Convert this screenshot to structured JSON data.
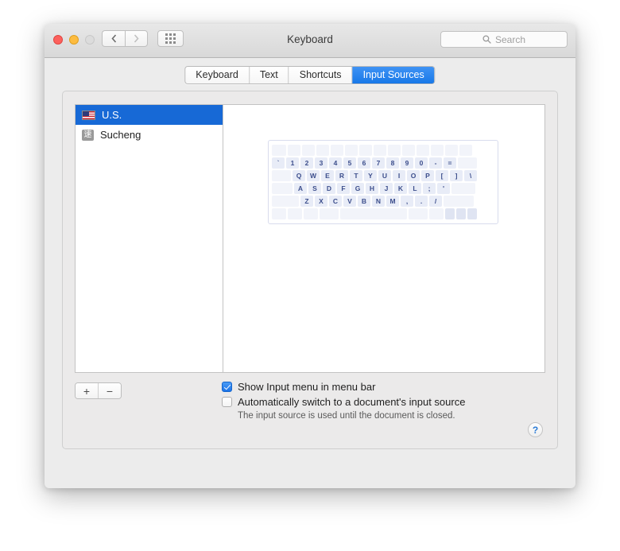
{
  "window": {
    "title": "Keyboard",
    "traffic_lights": {
      "close": "close-button",
      "minimize": "minimize-button",
      "zoom": "zoom-button"
    },
    "nav": {
      "back_icon": "chevron-left-icon",
      "forward_icon": "chevron-right-icon",
      "grid_icon": "show-all-grid-icon"
    }
  },
  "search": {
    "placeholder": "Search",
    "value": "",
    "icon": "search-icon"
  },
  "tabs": [
    {
      "label": "Keyboard",
      "active": false
    },
    {
      "label": "Text",
      "active": false
    },
    {
      "label": "Shortcuts",
      "active": false
    },
    {
      "label": "Input Sources",
      "active": true
    }
  ],
  "input_sources": [
    {
      "label": "U.S.",
      "icon": "us-flag-icon",
      "selected": true
    },
    {
      "label": "Sucheng",
      "icon": "sucheng-ime-icon",
      "icon_glyph": "速",
      "selected": false
    }
  ],
  "source_buttons": {
    "add_label": "+",
    "remove_label": "−"
  },
  "keyboard_preview": {
    "rows": [
      [
        {
          "label": "",
          "w": "w18",
          "blank": true
        },
        {
          "label": "",
          "w": "w16",
          "blank": true
        },
        {
          "label": "",
          "w": "w16",
          "blank": true
        },
        {
          "label": "",
          "w": "w16",
          "blank": true
        },
        {
          "label": "",
          "w": "w16",
          "blank": true
        },
        {
          "label": "",
          "w": "w16",
          "blank": true
        },
        {
          "label": "",
          "w": "w16",
          "blank": true
        },
        {
          "label": "",
          "w": "w16",
          "blank": true
        },
        {
          "label": "",
          "w": "w16",
          "blank": true
        },
        {
          "label": "",
          "w": "w16",
          "blank": true
        },
        {
          "label": "",
          "w": "w16",
          "blank": true
        },
        {
          "label": "",
          "w": "w16",
          "blank": true
        },
        {
          "label": "",
          "w": "w16",
          "blank": true
        },
        {
          "label": "",
          "w": "w16",
          "blank": true
        }
      ],
      [
        {
          "label": "`",
          "w": "w16"
        },
        {
          "label": "1",
          "w": "w16"
        },
        {
          "label": "2",
          "w": "w16"
        },
        {
          "label": "3",
          "w": "w16"
        },
        {
          "label": "4",
          "w": "w16"
        },
        {
          "label": "5",
          "w": "w16"
        },
        {
          "label": "6",
          "w": "w16"
        },
        {
          "label": "7",
          "w": "w16"
        },
        {
          "label": "8",
          "w": "w16"
        },
        {
          "label": "9",
          "w": "w16"
        },
        {
          "label": "0",
          "w": "w16"
        },
        {
          "label": "-",
          "w": "w16"
        },
        {
          "label": "=",
          "w": "w16"
        },
        {
          "label": "",
          "w": "w24",
          "blank": true
        }
      ],
      [
        {
          "label": "",
          "w": "w24",
          "blank": true
        },
        {
          "label": "Q",
          "w": "w16"
        },
        {
          "label": "W",
          "w": "w16"
        },
        {
          "label": "E",
          "w": "w16"
        },
        {
          "label": "R",
          "w": "w16"
        },
        {
          "label": "T",
          "w": "w16"
        },
        {
          "label": "Y",
          "w": "w16"
        },
        {
          "label": "U",
          "w": "w16"
        },
        {
          "label": "I",
          "w": "w16"
        },
        {
          "label": "O",
          "w": "w16"
        },
        {
          "label": "P",
          "w": "w16"
        },
        {
          "label": "[",
          "w": "w16"
        },
        {
          "label": "]",
          "w": "w16"
        },
        {
          "label": "\\",
          "w": "w16"
        }
      ],
      [
        {
          "label": "",
          "w": "w26",
          "blank": true
        },
        {
          "label": "A",
          "w": "w16"
        },
        {
          "label": "S",
          "w": "w16"
        },
        {
          "label": "D",
          "w": "w16"
        },
        {
          "label": "F",
          "w": "w16"
        },
        {
          "label": "G",
          "w": "w16"
        },
        {
          "label": "H",
          "w": "w16"
        },
        {
          "label": "J",
          "w": "w16"
        },
        {
          "label": "K",
          "w": "w16"
        },
        {
          "label": "L",
          "w": "w16"
        },
        {
          "label": ";",
          "w": "w16"
        },
        {
          "label": "'",
          "w": "w16"
        },
        {
          "label": "",
          "w": "w30",
          "blank": true
        }
      ],
      [
        {
          "label": "",
          "w": "w34",
          "blank": true
        },
        {
          "label": "Z",
          "w": "w16"
        },
        {
          "label": "X",
          "w": "w16"
        },
        {
          "label": "C",
          "w": "w16"
        },
        {
          "label": "V",
          "w": "w16"
        },
        {
          "label": "B",
          "w": "w16"
        },
        {
          "label": "N",
          "w": "w16"
        },
        {
          "label": "M",
          "w": "w16"
        },
        {
          "label": ",",
          "w": "w16"
        },
        {
          "label": ".",
          "w": "w16"
        },
        {
          "label": "/",
          "w": "w16"
        },
        {
          "label": "",
          "w": "w38",
          "blank": true
        }
      ],
      [
        {
          "label": "",
          "w": "w18",
          "blank": true
        },
        {
          "label": "",
          "w": "w18",
          "blank": true
        },
        {
          "label": "",
          "w": "w18",
          "blank": true
        },
        {
          "label": "",
          "w": "w24",
          "blank": true
        },
        {
          "label": "",
          "w": "w84",
          "blank": true
        },
        {
          "label": "",
          "w": "w24",
          "blank": true
        },
        {
          "label": "",
          "w": "w18",
          "blank": true
        },
        {
          "label": "",
          "w": "w12",
          "blank": true,
          "pad": true
        },
        {
          "label": "",
          "w": "w12",
          "blank": true,
          "pad": true
        },
        {
          "label": "",
          "w": "w12",
          "blank": true,
          "pad": true
        }
      ]
    ]
  },
  "options": {
    "show_input_menu": {
      "label": "Show Input menu in menu bar",
      "checked": true
    },
    "auto_switch": {
      "label": "Automatically switch to a document's input source",
      "checked": false,
      "hint": "The input source is used until the document is closed."
    }
  },
  "help": {
    "label": "?"
  }
}
